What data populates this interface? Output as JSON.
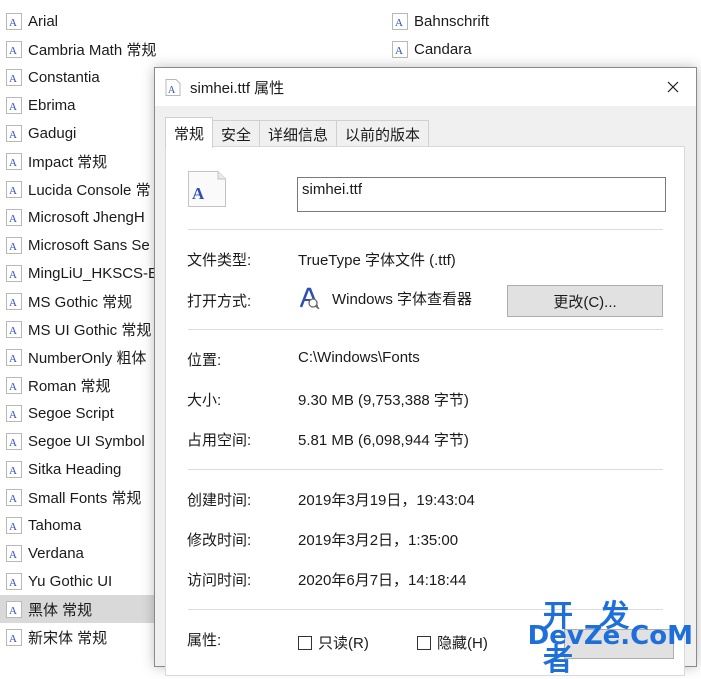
{
  "font_list": [
    {
      "name": "Arial"
    },
    {
      "name": "Bahnschrift"
    },
    {
      "name": "Cambria Math 常规"
    },
    {
      "name": "Candara"
    },
    {
      "name": "Constantia"
    },
    {
      "name": "Ebrima"
    },
    {
      "name": "Gadugi"
    },
    {
      "name": "Impact 常规"
    },
    {
      "name": "Lucida Console 常"
    },
    {
      "name": "Microsoft JhengH"
    },
    {
      "name": "Microsoft Sans Se"
    },
    {
      "name": "MingLiU_HKSCS-E"
    },
    {
      "name": "MS Gothic 常规"
    },
    {
      "name": "MS UI Gothic 常规"
    },
    {
      "name": "NumberOnly 粗体"
    },
    {
      "name": "Roman 常规"
    },
    {
      "name": "Segoe Script"
    },
    {
      "name": "Segoe UI Symbol"
    },
    {
      "name": "Sitka Heading"
    },
    {
      "name": "Small Fonts 常规"
    },
    {
      "name": "Tahoma"
    },
    {
      "name": "Verdana"
    },
    {
      "name": "Yu Gothic UI"
    },
    {
      "name": "黑体 常规"
    },
    {
      "name": "新宋体 常规"
    }
  ],
  "dialog": {
    "title": "simhei.ttf 属性",
    "close_icon": "close-icon",
    "tabs": [
      {
        "label": "常规",
        "active": true
      },
      {
        "label": "安全",
        "active": false
      },
      {
        "label": "详细信息",
        "active": false
      },
      {
        "label": "以前的版本",
        "active": false
      }
    ],
    "filename": "simhei.ttf",
    "file_type_label": "文件类型:",
    "file_type_value": "TrueType 字体文件 (.ttf)",
    "open_with_label": "打开方式:",
    "open_with_app": "Windows 字体查看器",
    "change_button": "更改(C)...",
    "location_label": "位置:",
    "location_value": "C:\\Windows\\Fonts",
    "size_label": "大小:",
    "size_value": "9.30 MB (9,753,388 字节)",
    "size_on_disk_label": "占用空间:",
    "size_on_disk_value": "5.81 MB (6,098,944 字节)",
    "created_label": "创建时间:",
    "created_value": "2019年3月19日，19:43:04",
    "modified_label": "修改时间:",
    "modified_value": "2019年3月2日，1:35:00",
    "accessed_label": "访问时间:",
    "accessed_value": "2020年6月7日，14:18:44",
    "attributes_label": "属性:",
    "readonly_label": "只读(R)",
    "hidden_label": "隐藏(H)"
  },
  "watermark": {
    "top": "开 发 者",
    "bottom": "DevZe.CoM"
  },
  "colors": {
    "selected_row": "#d9d9d9",
    "dialog_bg": "#f0f0f0",
    "button_bg": "#e1e1e1",
    "watermark": "#1e6fd9",
    "font_icon_accent": "#2b4fb5"
  }
}
